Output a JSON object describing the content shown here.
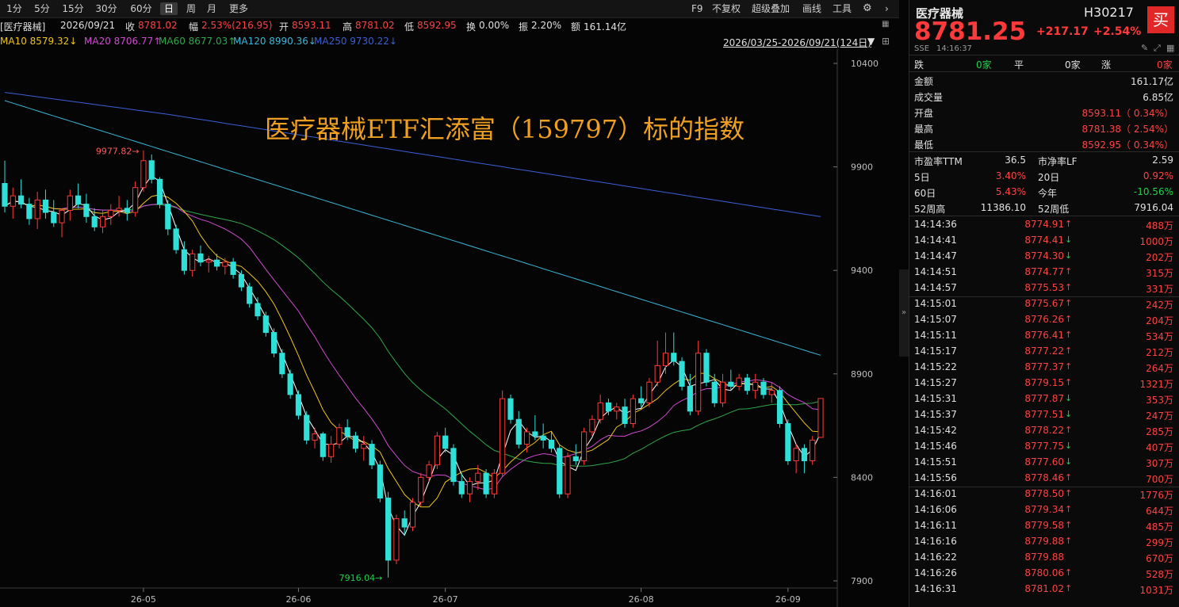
{
  "toolbar": {
    "timeframes": [
      "1分",
      "5分",
      "15分",
      "30分",
      "60分",
      "日",
      "周",
      "月",
      "更多"
    ],
    "active": "日",
    "right_tools": [
      "F9",
      "不复权",
      "超级叠加",
      "画线",
      "工具"
    ]
  },
  "info": {
    "name": "[医疗器械]",
    "date": "2026/09/21",
    "close_label": "收",
    "close_val": "8781.02",
    "amp_label": "幅",
    "amp_val": "2.53%(216.95)",
    "open_label": "开",
    "open_val": "8593.11",
    "high_label": "高",
    "high_val": "8781.02",
    "low_label": "低",
    "low_val": "8592.95",
    "turnover_label": "换",
    "turnover_val": "0.00%",
    "swing_label": "振",
    "swing_val": "2.20%",
    "amount_label": "额",
    "amount_val": "161.14亿"
  },
  "ma": {
    "ma10": "MA10 8579.32↓",
    "ma20": "MA20 8706.77↑",
    "ma60": "MA60 8677.03↑",
    "ma120": "MA120 8990.36↓",
    "ma250": "MA250 9730.22↓",
    "range": "2026/03/25-2026/09/21(124日)"
  },
  "overlay_title": "医疗器械ETF汇添富（159797）标的指数",
  "chart_data": {
    "type": "candlestick",
    "y_ticks": [
      "10400",
      "9900",
      "9400",
      "8900",
      "8400",
      "7900"
    ],
    "x_ticks": [
      "26-05",
      "26-06",
      "26-07",
      "26-08",
      "26-09"
    ],
    "ylim": [
      7900,
      10400
    ],
    "annotations": {
      "high": "9977.82",
      "low": "7916.04"
    },
    "colors": {
      "up": "#ff3a3a",
      "down": "#2fe0d8",
      "ma5": "#ffffff",
      "ma10": "#f0c419",
      "ma20": "#d04ad0",
      "ma60": "#2fa84a",
      "ma120": "#3ab7d8",
      "ma250": "#3b5fd6"
    },
    "candles": [
      [
        9820,
        9930,
        9680,
        9710
      ],
      [
        9710,
        9800,
        9650,
        9760
      ],
      [
        9760,
        9840,
        9700,
        9720
      ],
      [
        9720,
        9750,
        9620,
        9650
      ],
      [
        9650,
        9780,
        9600,
        9740
      ],
      [
        9740,
        9790,
        9650,
        9680
      ],
      [
        9680,
        9740,
        9610,
        9630
      ],
      [
        9630,
        9700,
        9560,
        9690
      ],
      [
        9690,
        9790,
        9640,
        9760
      ],
      [
        9760,
        9820,
        9700,
        9720
      ],
      [
        9720,
        9770,
        9630,
        9660
      ],
      [
        9660,
        9700,
        9590,
        9610
      ],
      [
        9610,
        9690,
        9580,
        9660
      ],
      [
        9660,
        9720,
        9620,
        9690
      ],
      [
        9690,
        9760,
        9660,
        9700
      ],
      [
        9700,
        9740,
        9640,
        9680
      ],
      [
        9680,
        9830,
        9660,
        9800
      ],
      [
        9800,
        9980,
        9780,
        9930
      ],
      [
        9930,
        9960,
        9820,
        9840
      ],
      [
        9840,
        9850,
        9700,
        9720
      ],
      [
        9720,
        9740,
        9570,
        9600
      ],
      [
        9600,
        9620,
        9480,
        9500
      ],
      [
        9500,
        9540,
        9380,
        9400
      ],
      [
        9400,
        9500,
        9370,
        9480
      ],
      [
        9480,
        9520,
        9420,
        9440
      ],
      [
        9440,
        9470,
        9390,
        9450
      ],
      [
        9450,
        9480,
        9400,
        9420
      ],
      [
        9420,
        9460,
        9380,
        9440
      ],
      [
        9440,
        9460,
        9360,
        9380
      ],
      [
        9380,
        9400,
        9300,
        9320
      ],
      [
        9320,
        9340,
        9220,
        9240
      ],
      [
        9240,
        9270,
        9160,
        9180
      ],
      [
        9180,
        9200,
        9080,
        9100
      ],
      [
        9100,
        9120,
        8980,
        9000
      ],
      [
        9000,
        9020,
        8880,
        8900
      ],
      [
        8900,
        8920,
        8780,
        8800
      ],
      [
        8800,
        8820,
        8680,
        8700
      ],
      [
        8700,
        8720,
        8560,
        8580
      ],
      [
        8580,
        8640,
        8540,
        8610
      ],
      [
        8610,
        8620,
        8480,
        8500
      ],
      [
        8500,
        8600,
        8470,
        8560
      ],
      [
        8560,
        8660,
        8540,
        8640
      ],
      [
        8640,
        8680,
        8580,
        8600
      ],
      [
        8600,
        8620,
        8520,
        8540
      ],
      [
        8540,
        8600,
        8480,
        8560
      ],
      [
        8560,
        8580,
        8440,
        8460
      ],
      [
        8460,
        8480,
        8280,
        8300
      ],
      [
        8300,
        8330,
        7916,
        8000
      ],
      [
        8000,
        8220,
        7980,
        8200
      ],
      [
        8200,
        8240,
        8120,
        8160
      ],
      [
        8160,
        8300,
        8140,
        8280
      ],
      [
        8280,
        8420,
        8260,
        8400
      ],
      [
        8400,
        8480,
        8380,
        8460
      ],
      [
        8460,
        8620,
        8440,
        8600
      ],
      [
        8600,
        8640,
        8520,
        8540
      ],
      [
        8540,
        8560,
        8360,
        8380
      ],
      [
        8380,
        8420,
        8300,
        8320
      ],
      [
        8320,
        8400,
        8280,
        8380
      ],
      [
        8380,
        8460,
        8340,
        8420
      ],
      [
        8420,
        8440,
        8300,
        8320
      ],
      [
        8320,
        8440,
        8300,
        8420
      ],
      [
        8420,
        8820,
        8400,
        8780
      ],
      [
        8780,
        8800,
        8660,
        8680
      ],
      [
        8680,
        8720,
        8540,
        8560
      ],
      [
        8560,
        8640,
        8520,
        8620
      ],
      [
        8620,
        8700,
        8580,
        8600
      ],
      [
        8600,
        8660,
        8540,
        8580
      ],
      [
        8580,
        8620,
        8520,
        8540
      ],
      [
        8540,
        8560,
        8300,
        8320
      ],
      [
        8320,
        8520,
        8300,
        8500
      ],
      [
        8500,
        8560,
        8460,
        8480
      ],
      [
        8480,
        8640,
        8460,
        8620
      ],
      [
        8620,
        8700,
        8600,
        8680
      ],
      [
        8680,
        8800,
        8660,
        8760
      ],
      [
        8760,
        8780,
        8700,
        8720
      ],
      [
        8720,
        8760,
        8680,
        8740
      ],
      [
        8740,
        8780,
        8640,
        8660
      ],
      [
        8660,
        8800,
        8640,
        8780
      ],
      [
        8780,
        8840,
        8740,
        8760
      ],
      [
        8760,
        8880,
        8740,
        8860
      ],
      [
        8860,
        9060,
        8840,
        8940
      ],
      [
        8940,
        9100,
        8900,
        9000
      ],
      [
        9000,
        9100,
        8940,
        8960
      ],
      [
        8960,
        8980,
        8820,
        8840
      ],
      [
        8840,
        8900,
        8700,
        8720
      ],
      [
        8720,
        9060,
        8700,
        9000
      ],
      [
        9000,
        9020,
        8840,
        8860
      ],
      [
        8860,
        8900,
        8740,
        8760
      ],
      [
        8760,
        8900,
        8740,
        8860
      ],
      [
        8860,
        8920,
        8820,
        8840
      ],
      [
        8840,
        8900,
        8820,
        8880
      ],
      [
        8880,
        8900,
        8800,
        8820
      ],
      [
        8820,
        8900,
        8780,
        8860
      ],
      [
        8860,
        8880,
        8780,
        8800
      ],
      [
        8800,
        8860,
        8760,
        8820
      ],
      [
        8820,
        8840,
        8640,
        8660
      ],
      [
        8660,
        8680,
        8460,
        8480
      ],
      [
        8480,
        8560,
        8420,
        8540
      ],
      [
        8540,
        8560,
        8420,
        8480
      ],
      [
        8480,
        8600,
        8460,
        8580
      ],
      [
        8593,
        8781,
        8593,
        8781
      ]
    ]
  },
  "side": {
    "name": "医疗器械",
    "code": "H30217",
    "price": "8781.25",
    "change": "+217.17",
    "pct": "+2.54%",
    "buy": "买",
    "exch": "SSE",
    "time": "14:16:37",
    "breadth": {
      "fall_label": "跌",
      "fall_val": "0家",
      "flat_label": "平",
      "flat_val": "0家",
      "rise_label": "涨",
      "rise_val": "0家"
    },
    "stats": [
      {
        "label": "金额",
        "value": "161.17亿",
        "color": "white"
      },
      {
        "label": "成交量",
        "value": "6.85亿",
        "color": "white"
      },
      {
        "label": "开盘",
        "value": "8593.11（ 0.34%）",
        "color": "red"
      },
      {
        "label": "最高",
        "value": "8781.38（ 2.54%）",
        "color": "red"
      },
      {
        "label": "最低",
        "value": "8592.95（ 0.34%）",
        "color": "red"
      }
    ],
    "valuation": [
      {
        "l1": "市盈率TTM",
        "v1": "36.5",
        "c1": "white",
        "l2": "市净率LF",
        "v2": "2.59",
        "c2": "white"
      },
      {
        "l1": "5日",
        "v1": "3.40%",
        "c1": "red",
        "l2": "20日",
        "v2": "0.92%",
        "c2": "red"
      },
      {
        "l1": "60日",
        "v1": "5.43%",
        "c1": "red",
        "l2": "今年",
        "v2": "-10.56%",
        "c2": "green"
      },
      {
        "l1": "52周高",
        "v1": "11386.10",
        "c1": "white",
        "l2": "52周低",
        "v2": "7916.04",
        "c2": "white"
      }
    ],
    "ticks": [
      {
        "t": "14:14:36",
        "p": "8774.91",
        "d": "up",
        "v": "488万"
      },
      {
        "t": "14:14:41",
        "p": "8774.41",
        "d": "down",
        "v": "1000万"
      },
      {
        "t": "14:14:47",
        "p": "8774.30",
        "d": "down",
        "v": "202万"
      },
      {
        "t": "14:14:51",
        "p": "8774.77",
        "d": "up",
        "v": "315万"
      },
      {
        "t": "14:14:57",
        "p": "8775.53",
        "d": "up",
        "v": "331万"
      },
      {
        "t": "14:15:01",
        "p": "8775.67",
        "d": "up",
        "v": "242万"
      },
      {
        "t": "14:15:07",
        "p": "8776.26",
        "d": "up",
        "v": "204万"
      },
      {
        "t": "14:15:11",
        "p": "8776.41",
        "d": "up",
        "v": "534万"
      },
      {
        "t": "14:15:17",
        "p": "8777.22",
        "d": "up",
        "v": "212万"
      },
      {
        "t": "14:15:22",
        "p": "8777.37",
        "d": "up",
        "v": "264万"
      },
      {
        "t": "14:15:27",
        "p": "8779.15",
        "d": "up",
        "v": "1321万"
      },
      {
        "t": "14:15:31",
        "p": "8777.87",
        "d": "down",
        "v": "353万"
      },
      {
        "t": "14:15:37",
        "p": "8777.51",
        "d": "down",
        "v": "247万"
      },
      {
        "t": "14:15:42",
        "p": "8778.22",
        "d": "up",
        "v": "285万"
      },
      {
        "t": "14:15:46",
        "p": "8777.75",
        "d": "down",
        "v": "407万"
      },
      {
        "t": "14:15:51",
        "p": "8777.60",
        "d": "down",
        "v": "307万"
      },
      {
        "t": "14:15:56",
        "p": "8778.46",
        "d": "up",
        "v": "700万"
      },
      {
        "t": "14:16:01",
        "p": "8778.50",
        "d": "up",
        "v": "1776万"
      },
      {
        "t": "14:16:06",
        "p": "8779.34",
        "d": "up",
        "v": "644万"
      },
      {
        "t": "14:16:11",
        "p": "8779.58",
        "d": "up",
        "v": "485万"
      },
      {
        "t": "14:16:16",
        "p": "8779.88",
        "d": "up",
        "v": "299万"
      },
      {
        "t": "14:16:22",
        "p": "8779.88",
        "d": "flat",
        "v": "670万"
      },
      {
        "t": "14:16:26",
        "p": "8780.06",
        "d": "up",
        "v": "528万"
      },
      {
        "t": "14:16:31",
        "p": "8781.02",
        "d": "up",
        "v": "1031万"
      }
    ]
  }
}
